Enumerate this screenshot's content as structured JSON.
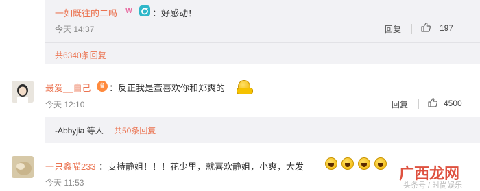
{
  "comments": [
    {
      "username": "一如既往的二吗",
      "text": "：好感动！",
      "time": "今天 14:37",
      "reply_label": "回复",
      "likes": "197"
    },
    {
      "username": "最爱__自己",
      "text": "：反正我是蛮喜欢你和郑爽的",
      "time": "今天 12:10",
      "reply_label": "回复",
      "likes": "4500"
    },
    {
      "username": "一只鑫喵233",
      "text": "：支持静姐！！！花少里，就喜欢静姐，小爽，大发",
      "time": "今天 11:53"
    }
  ],
  "more_replies": [
    {
      "text": "共6340条回复"
    },
    {
      "prefix": "-Abbyjia 等人 ",
      "text": "共50条回复"
    }
  ],
  "watermark": {
    "site": "广西龙网",
    "source": "头条号 / 时尚娱乐"
  },
  "colors": {
    "username": "#eb7350",
    "panel_bg": "#f2f2f5"
  }
}
